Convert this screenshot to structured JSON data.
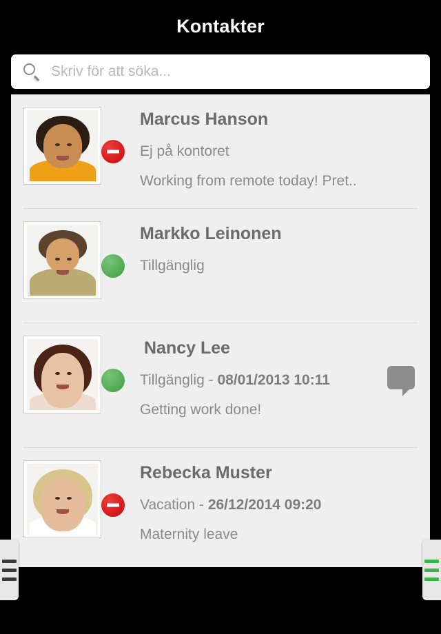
{
  "header": {
    "title": "Kontakter"
  },
  "search": {
    "placeholder": "Skriv för att söka...",
    "value": "",
    "icon": "search-icon"
  },
  "colors": {
    "background": "#000000",
    "panel": "#efefef",
    "title_text": "#ffffff",
    "name_text": "#6b6b6b",
    "status_text": "#8a8a8a",
    "available": "#54b054",
    "busy": "#e02222",
    "chat_icon": "#8d8d8d",
    "handle_left_bar": "#3a3a3a",
    "handle_right_bar": "#3bb34a",
    "separator": "#d9d9d9"
  },
  "contacts": [
    {
      "name": "Marcus Hanson",
      "presence": "dnd",
      "presence_icon": "busy-indicator-icon",
      "status": "Ej på kontoret",
      "timestamp": "",
      "message": "Working from remote today! Pret..",
      "has_chat_action": false,
      "avatar_alt": "Marcus Hanson avatar"
    },
    {
      "name": "Markko Leinonen",
      "presence": "available",
      "presence_icon": "available-indicator-icon",
      "status": "Tillgänglig",
      "timestamp": "",
      "message": "",
      "has_chat_action": false,
      "avatar_alt": "Markko Leinonen avatar"
    },
    {
      "name": "Nancy Lee",
      "presence": "available",
      "presence_icon": "available-indicator-icon",
      "status": "Tillgänglig - ",
      "timestamp": "08/01/2013 10:11",
      "message": "Getting work done!",
      "has_chat_action": true,
      "chat_icon": "chat-bubble-icon",
      "avatar_alt": "Nancy Lee avatar"
    },
    {
      "name": "Rebecka Muster",
      "presence": "dnd",
      "presence_icon": "busy-indicator-icon",
      "status": "Vacation - ",
      "timestamp": "26/12/2014 09:20",
      "message": "Maternity leave",
      "has_chat_action": false,
      "avatar_alt": "Rebecka Muster avatar"
    }
  ],
  "handles": {
    "left": {
      "name": "left-drag-handle",
      "bars": 3
    },
    "right": {
      "name": "right-drag-handle",
      "bars": 3
    }
  }
}
